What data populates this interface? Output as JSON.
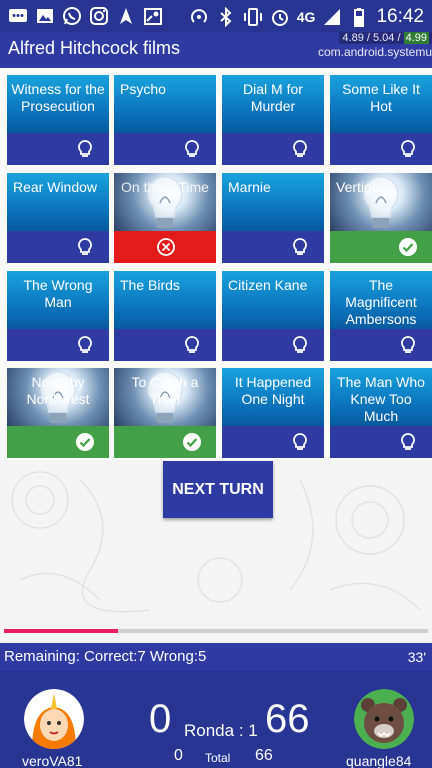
{
  "statusbar": {
    "network": "4G",
    "time": "16:42",
    "icons": [
      "message-icon",
      "image-icon",
      "whatsapp-icon",
      "instagram-icon",
      "arrow-icon",
      "map-icon",
      "hotspot-icon",
      "bluetooth-icon",
      "vibrate-icon",
      "alarm-icon",
      "signal-icon",
      "battery-icon"
    ]
  },
  "appbar": {
    "title": "Alfred Hitchcock films",
    "overlay_line1_a": "4.89 / 5.04 /",
    "overlay_line1_b": "4.99",
    "overlay_line2": "com.android.systemu"
  },
  "cards": [
    {
      "title": "Witness for the Prosecution",
      "state": "hidden",
      "icon": "lightbulb-icon"
    },
    {
      "title": "Psycho",
      "state": "hidden",
      "icon": "lightbulb-icon"
    },
    {
      "title": "Dial M for Murder",
      "state": "hidden",
      "icon": "lightbulb-icon"
    },
    {
      "title": "Some Like It Hot",
      "state": "hidden",
      "icon": "lightbulb-icon"
    },
    {
      "title": "Rear Window",
      "state": "hidden",
      "icon": "lightbulb-icon"
    },
    {
      "title": "On the... Time",
      "state": "wrong",
      "icon": "x-circle-icon"
    },
    {
      "title": "Marnie",
      "state": "hidden",
      "icon": "lightbulb-icon"
    },
    {
      "title": "Vertigo",
      "state": "correct",
      "icon": "check-circle-icon"
    },
    {
      "title": "The Wrong Man",
      "state": "hidden",
      "icon": "lightbulb-icon"
    },
    {
      "title": "The Birds",
      "state": "hidden",
      "icon": "lightbulb-icon"
    },
    {
      "title": "Citizen Kane",
      "state": "hidden",
      "icon": "lightbulb-icon"
    },
    {
      "title": "The Magnificent Ambersons",
      "state": "hidden",
      "icon": "lightbulb-icon"
    },
    {
      "title": "North by Northwest",
      "state": "correct",
      "icon": "check-circle-icon"
    },
    {
      "title": "To Catch a Thief",
      "state": "correct",
      "icon": "check-circle-icon"
    },
    {
      "title": "It Happened One Night",
      "state": "hidden",
      "icon": "lightbulb-icon"
    },
    {
      "title": "The Man Who Knew Too Much",
      "state": "hidden",
      "icon": "lightbulb-icon"
    }
  ],
  "next_turn_label": "NEXT TURN",
  "progress": {
    "fraction": 0.27,
    "color": "#e91e63"
  },
  "remaining": {
    "text": "Remaining:   Correct:7   Wrong:5",
    "time": "33'"
  },
  "score": {
    "player_left": "veroVA81",
    "player_right": "quangle84",
    "left_big": "0",
    "right_big": "66",
    "round_label": "Ronda : 1",
    "left_total": "0",
    "right_total": "66",
    "total_label": "Total"
  },
  "colors": {
    "primary": "#2f3aa3",
    "statusbar": "#283593",
    "correct": "#43a047",
    "wrong": "#e31b1b",
    "tile_blue": "#0c76bf"
  }
}
